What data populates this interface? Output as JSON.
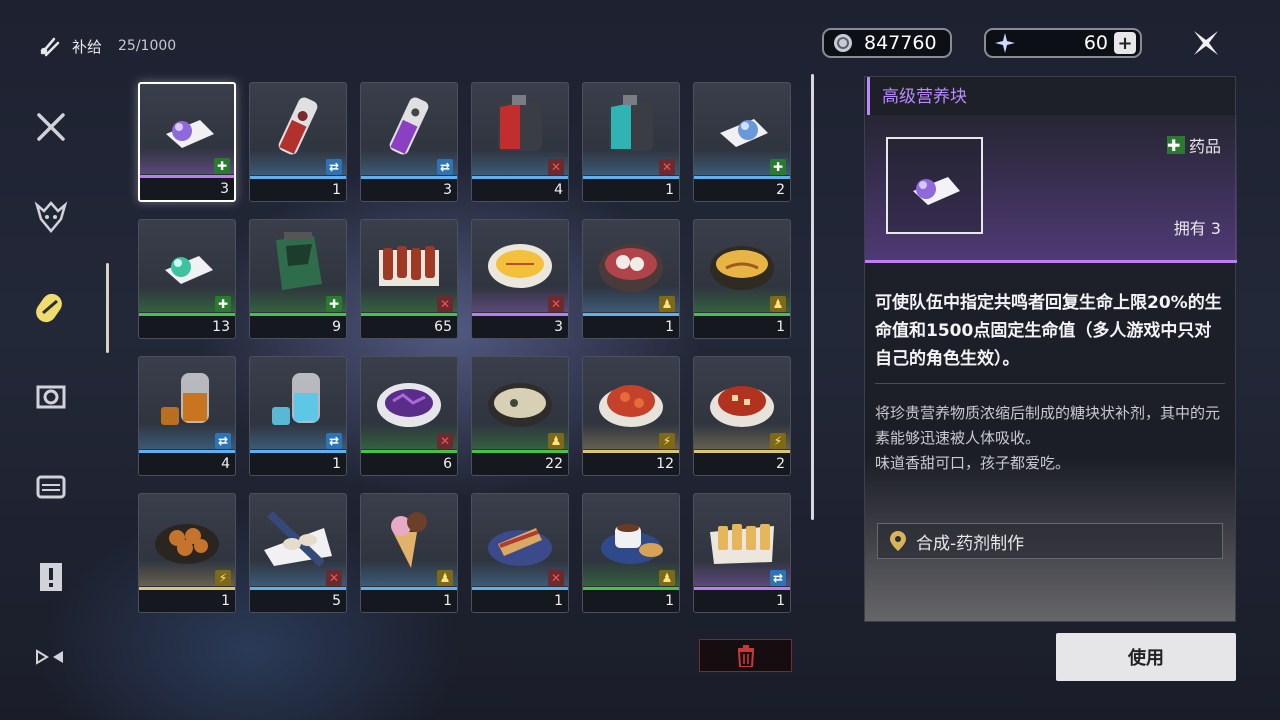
{
  "header": {
    "category": "补给",
    "capacity": "25/1000"
  },
  "currency": {
    "credit": "847760",
    "astrite": "60",
    "add_label": "+"
  },
  "sidenav": [
    "weapon-icon",
    "echo-icon",
    "supply-icon",
    "resource-icon",
    "material-icon",
    "quest-icon",
    "special-icon"
  ],
  "colors": {
    "green": "#44c24a",
    "blue": "#5fb0ee",
    "purple": "#c079f6",
    "gold": "#d9c47a"
  },
  "items": [
    {
      "name": "高级营养块",
      "count": "3",
      "rarity": "purple",
      "badge": "green",
      "badge_glyph": "✚",
      "icon": "candy-icon",
      "selected": true
    },
    {
      "name": "",
      "count": "1",
      "rarity": "blue",
      "badge": "blue",
      "badge_glyph": "⇄",
      "icon": "red-canister-icon"
    },
    {
      "name": "",
      "count": "3",
      "rarity": "blue",
      "badge": "blue",
      "badge_glyph": "⇄",
      "icon": "purple-canister-icon"
    },
    {
      "name": "",
      "count": "4",
      "rarity": "blue",
      "badge": "red",
      "badge_glyph": "✕",
      "icon": "red-injector-icon"
    },
    {
      "name": "",
      "count": "1",
      "rarity": "blue",
      "badge": "red",
      "badge_glyph": "✕",
      "icon": "teal-injector-icon"
    },
    {
      "name": "",
      "count": "2",
      "rarity": "blue",
      "badge": "green",
      "badge_glyph": "✚",
      "icon": "blue-candy-icon"
    },
    {
      "name": "",
      "count": "13",
      "rarity": "green",
      "badge": "green",
      "badge_glyph": "✚",
      "icon": "green-candy-icon"
    },
    {
      "name": "",
      "count": "9",
      "rarity": "green",
      "badge": "green",
      "badge_glyph": "✚",
      "icon": "green-pack-icon"
    },
    {
      "name": "",
      "count": "65",
      "rarity": "green",
      "badge": "red",
      "badge_glyph": "✕",
      "icon": "skewer-icon"
    },
    {
      "name": "",
      "count": "3",
      "rarity": "purple",
      "badge": "red",
      "badge_glyph": "✕",
      "icon": "omelette-icon"
    },
    {
      "name": "",
      "count": "1",
      "rarity": "blue",
      "badge": "yellow",
      "badge_glyph": "♟",
      "icon": "dumpling-bowl-icon"
    },
    {
      "name": "",
      "count": "1",
      "rarity": "green",
      "badge": "yellow",
      "badge_glyph": "♟",
      "icon": "curry-omelette-icon"
    },
    {
      "name": "",
      "count": "4",
      "rarity": "blue",
      "badge": "blue",
      "badge_glyph": "⇄",
      "icon": "amber-tea-icon"
    },
    {
      "name": "",
      "count": "1",
      "rarity": "blue",
      "badge": "blue",
      "badge_glyph": "⇄",
      "icon": "blue-tea-icon"
    },
    {
      "name": "",
      "count": "6",
      "rarity": "green",
      "badge": "red",
      "badge_glyph": "✕",
      "icon": "purple-salad-icon"
    },
    {
      "name": "",
      "count": "22",
      "rarity": "green",
      "badge": "yellow",
      "badge_glyph": "♟",
      "icon": "soup-icon"
    },
    {
      "name": "",
      "count": "12",
      "rarity": "gold",
      "badge": "yellow",
      "badge_glyph": "⚡",
      "icon": "red-stew-icon"
    },
    {
      "name": "",
      "count": "2",
      "rarity": "gold",
      "badge": "yellow",
      "badge_glyph": "⚡",
      "icon": "tofu-dish-icon"
    },
    {
      "name": "",
      "count": "1",
      "rarity": "gold",
      "badge": "yellow",
      "badge_glyph": "⚡",
      "icon": "bun-plate-icon"
    },
    {
      "name": "",
      "count": "5",
      "rarity": "blue",
      "badge": "red",
      "badge_glyph": "✕",
      "icon": "dumpling-plate-icon"
    },
    {
      "name": "",
      "count": "1",
      "rarity": "blue",
      "badge": "yellow",
      "badge_glyph": "♟",
      "icon": "ice-cream-icon"
    },
    {
      "name": "",
      "count": "1",
      "rarity": "blue",
      "badge": "red",
      "badge_glyph": "✕",
      "icon": "sandwich-icon"
    },
    {
      "name": "",
      "count": "1",
      "rarity": "green",
      "badge": "yellow",
      "badge_glyph": "♟",
      "icon": "coffee-bread-icon"
    },
    {
      "name": "",
      "count": "1",
      "rarity": "purple",
      "badge": "blue",
      "badge_glyph": "⇄",
      "icon": "fried-snack-icon"
    }
  ],
  "detail": {
    "title": "高级营养块",
    "type_label": "药品",
    "own_label": "拥有 3",
    "effect": "可使队伍中指定共鸣者回复生命上限20%的生命值和1500点固定生命值（多人游戏中只对自己的角色生效）。",
    "description_lines": [
      "将珍贵营养物质浓缩后制成的糖块状补剂，其中的元素能够迅速被人体吸收。",
      "味道香甜可口，孩子都爱吃。"
    ],
    "source": "合成-药剂制作"
  },
  "actions": {
    "use_label": "使用"
  }
}
